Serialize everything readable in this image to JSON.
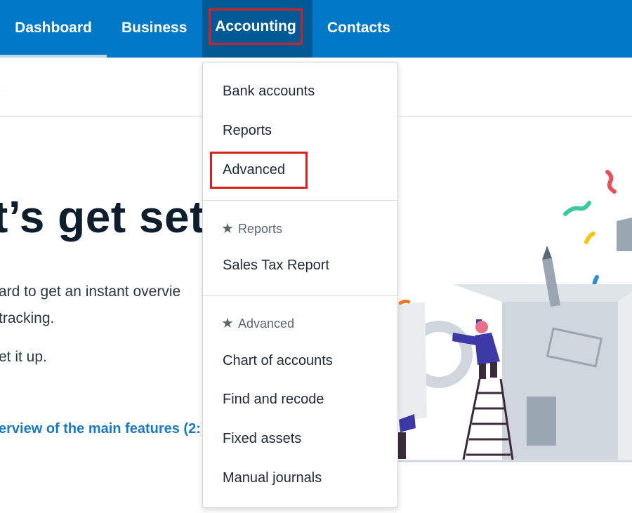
{
  "nav": {
    "dashboard": "Dashboard",
    "business": "Business",
    "accounting": "Accounting",
    "contacts": "Contacts"
  },
  "subheader": {
    "text": "s"
  },
  "main": {
    "title": "t’s get set",
    "para1": "ard to get an instant overvie",
    "para2": "tracking.",
    "para3": "et it up.",
    "video_link": "erview of the main features (2:"
  },
  "dropdown": {
    "items_top": [
      "Bank accounts",
      "Reports",
      "Advanced"
    ],
    "section_reports": {
      "heading": "Reports",
      "items": [
        "Sales Tax Report"
      ]
    },
    "section_advanced": {
      "heading": "Advanced",
      "items": [
        "Chart of accounts",
        "Find and recode",
        "Fixed assets",
        "Manual journals"
      ]
    },
    "star_icon": "star-icon"
  },
  "colors": {
    "nav_bg": "#0078c8",
    "nav_active_bg": "#005a96",
    "highlight_border": "#d62020",
    "link": "#1b78c2"
  }
}
